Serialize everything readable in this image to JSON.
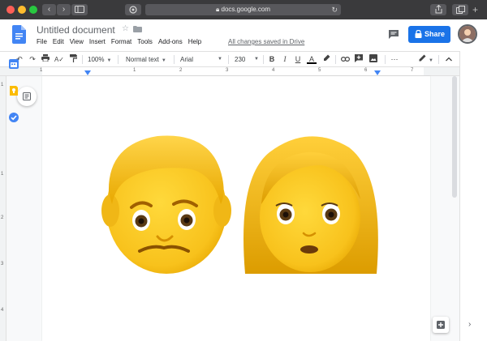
{
  "browser": {
    "url": "docs.google.com"
  },
  "doc": {
    "title": "Untitled document",
    "menu": [
      "File",
      "Edit",
      "View",
      "Insert",
      "Format",
      "Tools",
      "Add-ons",
      "Help"
    ],
    "save_status": "All changes saved in Drive",
    "share_label": "Share"
  },
  "toolbar": {
    "zoom": "100%",
    "style": "Normal text",
    "font": "Arial",
    "size": "230",
    "bold": "B",
    "italic": "I",
    "underline": "U",
    "text_color": "A",
    "more": "⋯"
  },
  "ruler": {
    "h_numbers": [
      "1",
      "1",
      "2",
      "3",
      "4",
      "5",
      "6",
      "7"
    ],
    "v_numbers": [
      "1",
      "1",
      "2",
      "3",
      "4"
    ]
  },
  "colors": {
    "docs_blue": "#4285f4",
    "share_blue": "#1a73e8",
    "emoji_yellow": "#ffcb2b",
    "emoji_hair": "#e0a500"
  },
  "icons": {
    "undo": "undo-icon",
    "redo": "redo-icon",
    "print": "print-icon",
    "spellcheck": "spellcheck-icon",
    "paint_format": "paint-format-icon",
    "highlight": "highlight-icon",
    "link": "link-icon",
    "comment": "add-comment-icon",
    "image": "insert-image-icon",
    "edit": "edit-mode-icon",
    "collapse": "collapse-icon"
  },
  "content": {
    "emojis": [
      "man-emoji",
      "woman-emoji"
    ]
  }
}
